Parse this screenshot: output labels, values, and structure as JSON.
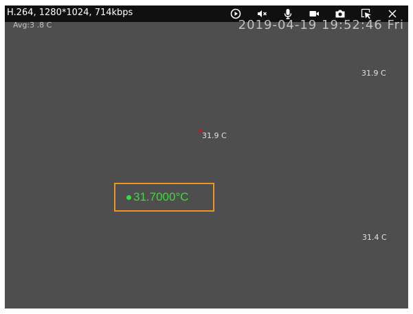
{
  "toolbar": {
    "codec_info": "H.264, 1280*1024, 714kbps",
    "icons": [
      "play-icon",
      "mute-icon",
      "microphone-icon",
      "record-icon",
      "snapshot-icon",
      "pointer-select-icon",
      "close-icon"
    ]
  },
  "osd": {
    "avg_label": "Avg:3 .8 C",
    "datetime": "2019-04-19 19:52:46 Fri"
  },
  "temperature_points": {
    "top_right": "31.9 C",
    "center": "31.9 C",
    "bottom_right": "31.4 C"
  },
  "readout": {
    "value": "31.7000°C",
    "box_color": "#f0961c",
    "text_color": "#3fd93f"
  },
  "colors": {
    "video_background": "#4e4e4e",
    "toolbar_background": "#101010",
    "spot_marker": "#c21b1b"
  }
}
